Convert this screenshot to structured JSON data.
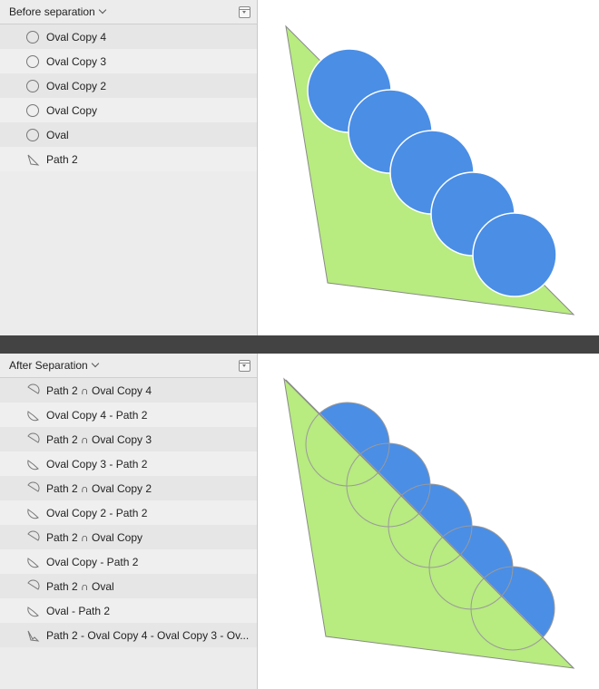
{
  "top_panel": {
    "title": "Before separation",
    "layers": [
      {
        "name": "Oval Copy 4",
        "icon": "oval-icon"
      },
      {
        "name": "Oval Copy 3",
        "icon": "oval-icon"
      },
      {
        "name": "Oval Copy 2",
        "icon": "oval-icon"
      },
      {
        "name": "Oval Copy",
        "icon": "oval-icon"
      },
      {
        "name": "Oval",
        "icon": "oval-icon"
      },
      {
        "name": "Path 2",
        "icon": "path-icon"
      }
    ]
  },
  "bottom_panel": {
    "title": "After Separation",
    "layers": [
      {
        "name": "Path 2 ∩ Oval Copy 4",
        "icon": "intersect-shape-icon"
      },
      {
        "name": "Oval Copy 4 - Path 2",
        "icon": "subtract-shape-icon"
      },
      {
        "name": "Path 2 ∩ Oval Copy 3",
        "icon": "intersect-shape-icon"
      },
      {
        "name": "Oval Copy 3 - Path 2",
        "icon": "subtract-shape-icon"
      },
      {
        "name": "Path 2 ∩ Oval Copy 2",
        "icon": "intersect-shape-icon"
      },
      {
        "name": "Oval Copy 2 - Path 2",
        "icon": "subtract-shape-icon"
      },
      {
        "name": "Path 2 ∩ Oval Copy",
        "icon": "intersect-shape-icon"
      },
      {
        "name": "Oval Copy - Path 2",
        "icon": "subtract-shape-icon"
      },
      {
        "name": "Path 2 ∩ Oval",
        "icon": "intersect-shape-icon"
      },
      {
        "name": "Oval - Path 2",
        "icon": "subtract-shape-icon"
      },
      {
        "name": "Path 2 - Oval Copy 4 - Oval Copy 3 - Ov...",
        "icon": "path-icon"
      }
    ]
  },
  "colors": {
    "shape_green": "#b8eb80",
    "shape_blue": "#4a8ee6",
    "sidebar_bg": "#ececec",
    "separator": "#434343"
  }
}
